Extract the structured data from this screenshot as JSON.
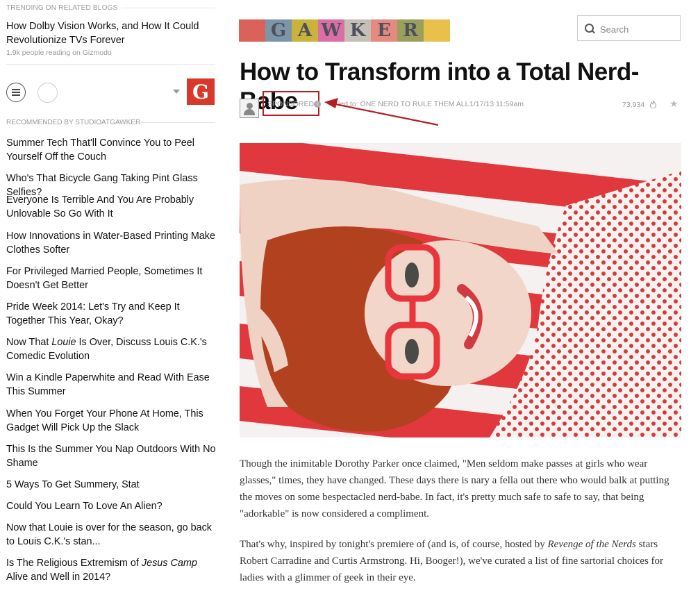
{
  "sidebar": {
    "trending_heading": "TRENDING ON RELATED BLOGS",
    "trending_title": "How Dolby Vision Works, and How It Could Revolutionize TVs Forever",
    "trending_meta": "1.9k people reading on Gizmodo",
    "logo_letter": "G",
    "recommended_heading": "RECOMMENDED BY STUDIOATGAWKER",
    "recommended": [
      {
        "label": "Summer Tech That'll Convince You to Peel Yourself Off the Couch"
      },
      {
        "label": "Who's That Bicycle Gang Taking Pint Glass Selfies?"
      },
      {
        "label": "Everyone Is Terrible And You Are Probably Unlovable So Go With It"
      },
      {
        "label": "How Innovations in Water-Based Printing Make Clothes Softer"
      },
      {
        "label": "For Privileged Married People, Sometimes It Doesn't Get Better"
      },
      {
        "label": "Pride Week 2014: Let's Try and Keep It Together This Year, Okay?"
      },
      {
        "pre": "Now That ",
        "italic": "Louie",
        "post": " Is Over, Discuss Louis C.K.'s Comedic Evolution"
      },
      {
        "label": "Win a Kindle Paperwhite and Read With Ease This Summer"
      },
      {
        "label": "When You Forget Your Phone At Home, This Gadget Will Pick Up the Slack"
      },
      {
        "label": "This Is the Summer You Nap Outdoors With No Shame"
      },
      {
        "label": "5 Ways To Get Summery, Stat"
      },
      {
        "label": "Could You Learn To Love An Alien?"
      },
      {
        "label": "Now that Louie is over for the season, go back to Louis C.K.'s stan..."
      },
      {
        "pre": "Is The Religious Extremism of ",
        "italic": "Jesus Camp",
        "post": " Alive and Well in 2014?"
      }
    ]
  },
  "header": {
    "logo_letters": [
      "",
      "G",
      "A",
      "W",
      "K",
      "E",
      "R",
      ""
    ],
    "logo_colors": [
      "#d9625a",
      "#7d95a8",
      "#c9b33a",
      "#d96fa5",
      "#c4c0b8",
      "#e48a7e",
      "#9aa05b",
      "#e8c04a"
    ],
    "search_placeholder": "Search"
  },
  "article": {
    "title": "How to Transform into a Total Nerd-Babe",
    "sponsored": "SPONSORED",
    "filed_to": "led to: ONE NERD TO RULE THEM ALL",
    "date": "1/17/13 11:59am",
    "views": "73,934",
    "body": [
      {
        "text": "Though the inimitable Dorothy Parker once claimed, \"Men seldom make passes at girls who wear glasses,\" times, they have changed. These days there is nary a fella out there who would balk at putting the moves on some bespectacled nerd-babe. In fact, it's pretty much safe to safe to say, that being \"adorkable\" is now considered a compliment."
      },
      {
        "pre": "That's why, inspired by tonight's premiere of (and is, of course, hosted by ",
        "italic": "Revenge of the Nerds",
        "post": " stars Robert Carradine and Curtis Armstrong. Hi, Booger!), we've curated a list of fine sartorial choices for ladies with a glimmer of geek in their eye."
      }
    ]
  },
  "colors": {
    "accent_red": "#b31e23",
    "brand_red": "#d8392b"
  }
}
